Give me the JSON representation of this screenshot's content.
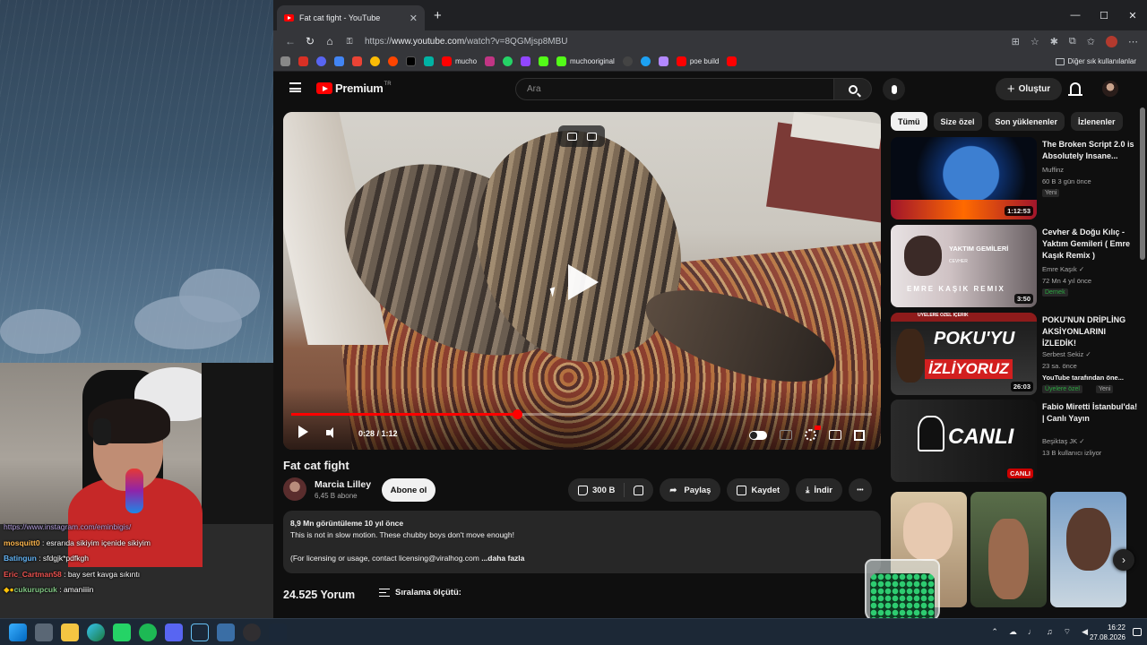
{
  "browser": {
    "tab_title": "Fat cat fight - YouTube",
    "tab_close": "✕",
    "new_tab": "+",
    "win_minimize": "—",
    "win_maximize": "☐",
    "win_close": "✕",
    "url_prefix": "https://",
    "url_domain": "www.youtube.com",
    "url_path": "/watch?v=8QGMjsp8MBU",
    "bookmarks": [
      "mucho",
      "muchooriginal",
      "poe build"
    ],
    "other_bookmarks": "Diğer sık kullanılanlar"
  },
  "masthead": {
    "logo_text": "Premium",
    "region": "TR",
    "search_placeholder": "Ara",
    "create_label": "Oluştur"
  },
  "player": {
    "time": "0:28 / 1:12",
    "progress": 0.389
  },
  "video": {
    "title": "Fat cat fight",
    "channel": "Marcia Lilley",
    "subscribers": "6,45 B abone",
    "subscribe_label": "Abone ol",
    "likes": "300 B",
    "share_label": "Paylaş",
    "save_label": "Kaydet",
    "download_label": "İndir",
    "more_label": "•••"
  },
  "description": {
    "meta": "8,9 Mn görüntüleme  10 yıl önce",
    "line1": "This is not in slow motion.  These chubby boys don't move enough!",
    "line2": "(For licensing or usage, contact licensing@viralhog.com ",
    "more": "...daha fazla"
  },
  "comments": {
    "count": "24.525 Yorum",
    "sort_label": "Sıralama ölçütü:"
  },
  "sidebar": {
    "chips": [
      "Tümü",
      "Size özel",
      "Son yüklenenler",
      "İzlenenler"
    ],
    "recs": [
      {
        "title": "The Broken Script 2.0 is Absolutely Insane...",
        "channel": "Muffinz",
        "meta": "60 B  3 gün önce",
        "badge": "Yeni",
        "duration": "1:12:53"
      },
      {
        "title": "Cevher & Doğu Kılıç - Yaktım Gemileri ( Emre Kaşık Remix )",
        "channel": "Emre Kaşık ✓",
        "meta": "72 Mn  4 yıl önce",
        "badge": "Dernek",
        "duration": "3:50",
        "thumb_text1": "YAKTIM GEMİLERİ",
        "thumb_text2": "CEVHER",
        "thumb_text3": "EMRE KAŞIK REMIX"
      },
      {
        "title": "POKU'NUN DRİPLİNG AKSİYONLARINI İZLEDİK!",
        "channel": "Serbest Sekiz ✓",
        "meta": "23 sa. önce",
        "meta2": "YouTube tarafından öne...",
        "badge": "Üyelere özel",
        "badge2": "Yeni",
        "duration": "26:03",
        "thumb_text1": "ÜYELERE ÖZEL İÇERİK",
        "thumb_text2": "POKU'YU",
        "thumb_text3": "İZLİYORUZ"
      },
      {
        "title": "Fabio Miretti İstanbul'da! | Canlı Yayın",
        "channel": "Beşiktaş JK ✓",
        "meta": "13 B kullanıcı izliyor",
        "duration": "CANLI",
        "thumb_text1": "CANLI"
      }
    ],
    "shorts_next": "›"
  },
  "chat": [
    {
      "user": "",
      "text": "https://www.instagram.com/eminbigis/",
      "color": "#b39ddb"
    },
    {
      "user": "mosquitt0",
      "text": " : esrarıda sikiyim içenide sikiyim",
      "color": "#ffb74d"
    },
    {
      "user": "Batingun",
      "text": " : sfdgjk*pdfkgh",
      "color": "#64b5f6"
    },
    {
      "user": "Eric_Cartman58",
      "text": " : bay sert kavga sıkıntı",
      "color": "#ef5350"
    },
    {
      "user": "cukurupcuk",
      "text": " : amaniiiin",
      "color": "#81c784"
    }
  ],
  "taskbar": {
    "time": "16:22",
    "date": "27.08.2026"
  },
  "colors": {
    "yt_red": "#ff0000",
    "bg": "#0f0f0f",
    "chip": "#272727"
  }
}
